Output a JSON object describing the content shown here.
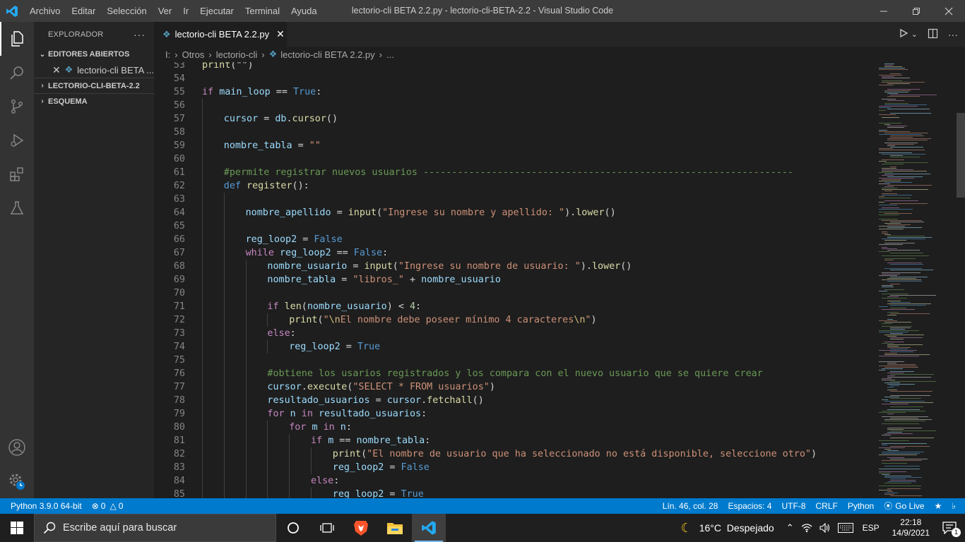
{
  "window": {
    "title": "lectorio-cli BETA 2.2.py - lectorio-cli-BETA-2.2 - Visual Studio Code",
    "menu": [
      "Archivo",
      "Editar",
      "Selección",
      "Ver",
      "Ir",
      "Ejecutar",
      "Terminal",
      "Ayuda"
    ]
  },
  "sidebar": {
    "title": "EXPLORADOR",
    "sections": {
      "open_editors": "EDITORES ABIERTOS",
      "open_editor_file": "lectorio-cli BETA ...",
      "project": "LECTORIO-CLI-BETA-2.2",
      "outline": "ESQUEMA"
    }
  },
  "editor": {
    "tab_label": "lectorio-cli BETA 2.2.py",
    "breadcrumb": [
      "I:",
      "Otros",
      "lectorio-cli",
      "lectorio-cli BETA 2.2.py",
      "..."
    ],
    "lines": [
      {
        "n": "53",
        "t": [
          [
            "fn",
            "print"
          ],
          [
            "",
            "(\"\")"
          ]
        ],
        "indent": 0
      },
      {
        "n": "54",
        "t": [],
        "indent": 0
      },
      {
        "n": "55",
        "t": [
          [
            "kw2",
            "if"
          ],
          [
            "",
            " "
          ],
          [
            "var",
            "main_loop"
          ],
          [
            "",
            " == "
          ],
          [
            "kw",
            "True"
          ],
          [
            "",
            ":"
          ]
        ],
        "indent": 0
      },
      {
        "n": "56",
        "t": [],
        "indent": 1
      },
      {
        "n": "57",
        "t": [
          [
            "var",
            "cursor"
          ],
          [
            "",
            " = "
          ],
          [
            "var",
            "db"
          ],
          [
            "",
            "."
          ],
          [
            "fn",
            "cursor"
          ],
          [
            "",
            "()"
          ]
        ],
        "indent": 1
      },
      {
        "n": "58",
        "t": [],
        "indent": 1
      },
      {
        "n": "59",
        "t": [
          [
            "var",
            "nombre_tabla"
          ],
          [
            "",
            " = "
          ],
          [
            "str",
            "\"\""
          ]
        ],
        "indent": 1
      },
      {
        "n": "60",
        "t": [],
        "indent": 1
      },
      {
        "n": "61",
        "t": [
          [
            "cm",
            "#permite registrar nuevos usuarios -----------------------------------------------------------------"
          ]
        ],
        "indent": 1
      },
      {
        "n": "62",
        "t": [
          [
            "kw",
            "def"
          ],
          [
            "",
            " "
          ],
          [
            "fn",
            "register"
          ],
          [
            "",
            "():"
          ]
        ],
        "indent": 1
      },
      {
        "n": "63",
        "t": [],
        "indent": 2
      },
      {
        "n": "64",
        "t": [
          [
            "var",
            "nombre_apellido"
          ],
          [
            "",
            " = "
          ],
          [
            "fn",
            "input"
          ],
          [
            "",
            "("
          ],
          [
            "str",
            "\"Ingrese su nombre y apellido: \""
          ],
          [
            "",
            ")."
          ],
          [
            "fn",
            "lower"
          ],
          [
            "",
            "()"
          ]
        ],
        "indent": 2
      },
      {
        "n": "65",
        "t": [],
        "indent": 2
      },
      {
        "n": "66",
        "t": [
          [
            "var",
            "reg_loop2"
          ],
          [
            "",
            " = "
          ],
          [
            "kw",
            "False"
          ]
        ],
        "indent": 2
      },
      {
        "n": "67",
        "t": [
          [
            "kw2",
            "while"
          ],
          [
            "",
            " "
          ],
          [
            "var",
            "reg_loop2"
          ],
          [
            "",
            " == "
          ],
          [
            "kw",
            "False"
          ],
          [
            "",
            ":"
          ]
        ],
        "indent": 2
      },
      {
        "n": "68",
        "t": [
          [
            "var",
            "nombre_usuario"
          ],
          [
            "",
            " = "
          ],
          [
            "fn",
            "input"
          ],
          [
            "",
            "("
          ],
          [
            "str",
            "\"Ingrese su nombre de usuario: \""
          ],
          [
            "",
            ")."
          ],
          [
            "fn",
            "lower"
          ],
          [
            "",
            "()"
          ]
        ],
        "indent": 3
      },
      {
        "n": "69",
        "t": [
          [
            "var",
            "nombre_tabla"
          ],
          [
            "",
            " = "
          ],
          [
            "str",
            "\"libros_\""
          ],
          [
            "",
            " + "
          ],
          [
            "var",
            "nombre_usuario"
          ]
        ],
        "indent": 3
      },
      {
        "n": "70",
        "t": [],
        "indent": 3
      },
      {
        "n": "71",
        "t": [
          [
            "kw2",
            "if"
          ],
          [
            "",
            " "
          ],
          [
            "fn",
            "len"
          ],
          [
            "",
            "("
          ],
          [
            "var",
            "nombre_usuario"
          ],
          [
            "",
            ") < "
          ],
          [
            "num",
            "4"
          ],
          [
            "",
            ":"
          ]
        ],
        "indent": 3
      },
      {
        "n": "72",
        "t": [
          [
            "fn",
            "print"
          ],
          [
            "",
            "("
          ],
          [
            "str",
            "\""
          ],
          [
            "esc",
            "\\n"
          ],
          [
            "str",
            "El nombre debe poseer mínimo 4 caracteres"
          ],
          [
            "esc",
            "\\n"
          ],
          [
            "str",
            "\""
          ],
          [
            "",
            ")"
          ]
        ],
        "indent": 4
      },
      {
        "n": "73",
        "t": [
          [
            "kw2",
            "else"
          ],
          [
            "",
            ":"
          ]
        ],
        "indent": 3
      },
      {
        "n": "74",
        "t": [
          [
            "var",
            "reg_loop2"
          ],
          [
            "",
            " = "
          ],
          [
            "kw",
            "True"
          ]
        ],
        "indent": 4
      },
      {
        "n": "75",
        "t": [],
        "indent": 3
      },
      {
        "n": "76",
        "t": [
          [
            "cm",
            "#obtiene los usarios registrados y los compara con el nuevo usuario que se quiere crear"
          ]
        ],
        "indent": 3
      },
      {
        "n": "77",
        "t": [
          [
            "var",
            "cursor"
          ],
          [
            "",
            "."
          ],
          [
            "fn",
            "execute"
          ],
          [
            "",
            "("
          ],
          [
            "str",
            "\"SELECT * FROM usuarios\""
          ],
          [
            "",
            ")"
          ]
        ],
        "indent": 3
      },
      {
        "n": "78",
        "t": [
          [
            "var",
            "resultado_usuarios"
          ],
          [
            "",
            " = "
          ],
          [
            "var",
            "cursor"
          ],
          [
            "",
            "."
          ],
          [
            "fn",
            "fetchall"
          ],
          [
            "",
            "()"
          ]
        ],
        "indent": 3
      },
      {
        "n": "79",
        "t": [
          [
            "kw2",
            "for"
          ],
          [
            "",
            " "
          ],
          [
            "var",
            "n"
          ],
          [
            "",
            " "
          ],
          [
            "kw2",
            "in"
          ],
          [
            "",
            " "
          ],
          [
            "var",
            "resultado_usuarios"
          ],
          [
            "",
            ":"
          ]
        ],
        "indent": 3
      },
      {
        "n": "80",
        "t": [
          [
            "kw2",
            "for"
          ],
          [
            "",
            " "
          ],
          [
            "var",
            "m"
          ],
          [
            "",
            " "
          ],
          [
            "kw2",
            "in"
          ],
          [
            "",
            " "
          ],
          [
            "var",
            "n"
          ],
          [
            "",
            ":"
          ]
        ],
        "indent": 4
      },
      {
        "n": "81",
        "t": [
          [
            "kw2",
            "if"
          ],
          [
            "",
            " "
          ],
          [
            "var",
            "m"
          ],
          [
            "",
            " == "
          ],
          [
            "var",
            "nombre_tabla"
          ],
          [
            "",
            ":"
          ]
        ],
        "indent": 5
      },
      {
        "n": "82",
        "t": [
          [
            "fn",
            "print"
          ],
          [
            "",
            "("
          ],
          [
            "str",
            "\"El nombre de usuario que ha seleccionado no está disponible, seleccione otro\""
          ],
          [
            "",
            ")"
          ]
        ],
        "indent": 6
      },
      {
        "n": "83",
        "t": [
          [
            "var",
            "reg_loop2"
          ],
          [
            "",
            " = "
          ],
          [
            "kw",
            "False"
          ]
        ],
        "indent": 6
      },
      {
        "n": "84",
        "t": [
          [
            "kw2",
            "else"
          ],
          [
            "",
            ":"
          ]
        ],
        "indent": 5
      },
      {
        "n": "85",
        "t": [
          [
            "var",
            "reg_loop2"
          ],
          [
            "",
            " = "
          ],
          [
            "kw",
            "True"
          ]
        ],
        "indent": 6
      }
    ]
  },
  "statusbar": {
    "python": "Python 3.9.0 64-bit",
    "errors": "0",
    "warnings": "0",
    "position": "Lín. 46, col. 28",
    "spaces": "Espacios: 4",
    "encoding": "UTF-8",
    "eol": "CRLF",
    "language": "Python",
    "golive": "Go Live"
  },
  "taskbar": {
    "search_placeholder": "Escribe aquí para buscar",
    "weather": "16°C  Despejado",
    "language": "ESP",
    "time": "22:18",
    "date": "14/9/2021",
    "notifications": "1"
  },
  "colors": {
    "accent": "#007acc",
    "python_icon": "#519aba"
  }
}
